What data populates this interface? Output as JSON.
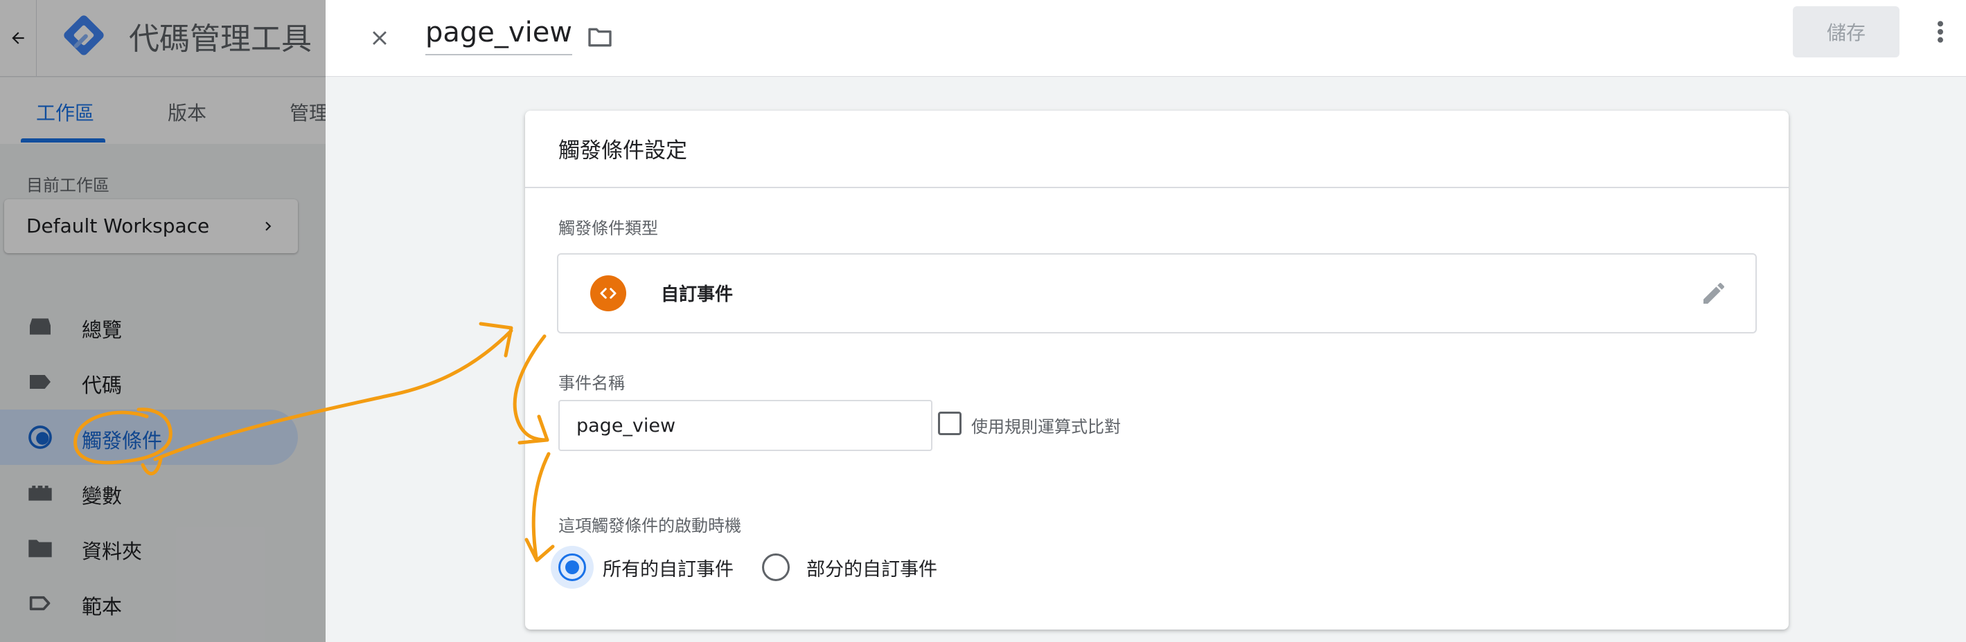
{
  "app": {
    "title": "代碼管理工具",
    "tabs": [
      {
        "label": "工作區",
        "active": true
      },
      {
        "label": "版本",
        "active": false
      },
      {
        "label": "管理",
        "active": false
      }
    ]
  },
  "workspace": {
    "label": "目前工作區",
    "name": "Default Workspace"
  },
  "nav": {
    "items": [
      {
        "label": "總覽",
        "icon": "overview-icon"
      },
      {
        "label": "代碼",
        "icon": "tag-icon"
      },
      {
        "label": "觸發條件",
        "icon": "trigger-icon",
        "active": true
      },
      {
        "label": "變數",
        "icon": "variable-icon"
      },
      {
        "label": "資料夾",
        "icon": "folder-icon"
      },
      {
        "label": "範本",
        "icon": "template-icon"
      }
    ]
  },
  "editor": {
    "name": "page_view",
    "save_label": "儲存",
    "card_title": "觸發條件設定",
    "type_label": "觸發條件類型",
    "type_name": "自訂事件",
    "event_label": "事件名稱",
    "event_value": "page_view",
    "regex_label": "使用規則運算式比對",
    "regex_checked": false,
    "fire_label": "這項觸發條件的啟動時機",
    "fire_options": [
      {
        "label": "所有的自訂事件",
        "selected": true
      },
      {
        "label": "部分的自訂事件",
        "selected": false
      }
    ]
  },
  "colors": {
    "accent": "#1a73e8",
    "trigger_type_icon": "#e8710a",
    "annotation": "#f39c12"
  }
}
